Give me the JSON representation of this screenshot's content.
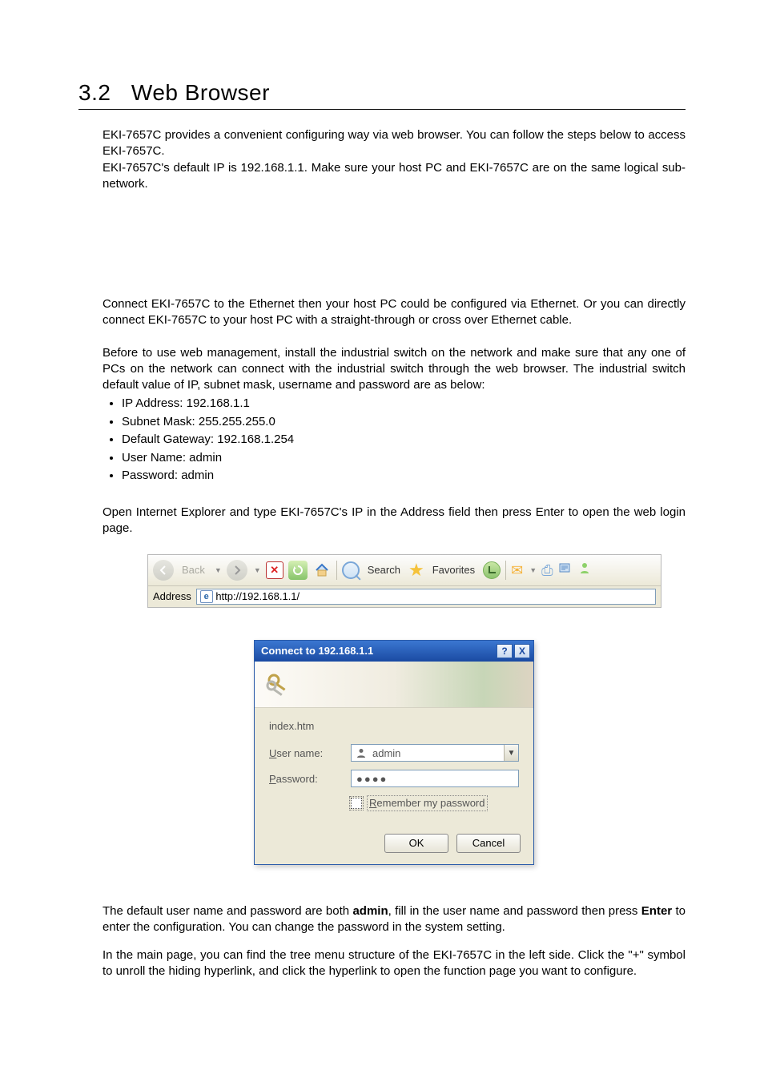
{
  "heading": {
    "number": "3.2",
    "title": "Web Browser"
  },
  "paras": {
    "p1": "EKI-7657C provides a convenient configuring way via web browser. You can follow the steps below to access EKI-7657C.",
    "p2": "EKI-7657C's default IP is 192.168.1.1. Make sure your host PC and EKI-7657C are on the same logical sub-network.",
    "p3": "Connect EKI-7657C to the Ethernet then your host PC could be configured via Ethernet. Or you can directly connect EKI-7657C to your host PC with a straight-through or cross over Ethernet cable.",
    "p4": "Before to use web management, install the industrial switch on the network and make sure that any one of PCs on the network can connect with the industrial switch through the web browser. The industrial switch default value of IP, subnet mask, username and password are as below:",
    "p5": "Open Internet Explorer and type EKI-7657C's IP in the Address field then press Enter to open the web login page.",
    "p6a": "The default user name and password are both ",
    "p6b": ", fill in the user name and password then press ",
    "p6c": " to enter the configuration. You can change the password in the system setting.",
    "p7": "In the main page, you can find the tree menu structure of the EKI-7657C in the left side. Click the \"+\" symbol to unroll the hiding hyperlink, and click the hyperlink to open the function page you want to configure."
  },
  "defaults": {
    "ip": "IP Address: 192.168.1.1",
    "mask": "Subnet Mask: 255.255.255.0",
    "gw": "Default Gateway: 192.168.1.254",
    "user": "User Name: admin",
    "pass": "Password: admin"
  },
  "toolbar": {
    "back": "Back",
    "search": "Search",
    "favorites": "Favorites",
    "address_label": "Address",
    "address_value": "http://192.168.1.1/"
  },
  "dialog": {
    "title": "Connect to 192.168.1.1",
    "realm": "index.htm",
    "user_label": "User name:",
    "pass_label": "Password:",
    "user_value": "admin",
    "pass_mask": "●●●●",
    "remember": "Remember my password",
    "ok": "OK",
    "cancel": "Cancel",
    "help": "?",
    "close": "X"
  },
  "credentials_bold": "admin",
  "enter_bold": "Enter"
}
